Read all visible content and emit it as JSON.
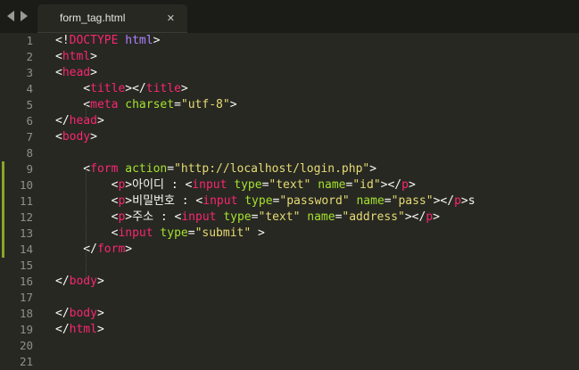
{
  "tab": {
    "title": "form_tag.html"
  },
  "lines": [
    {
      "n": "1",
      "parts": [
        [
          "p",
          "<!"
        ],
        [
          "t",
          "DOCTYPE"
        ],
        [
          "p",
          " "
        ],
        [
          "k",
          "html"
        ],
        [
          "p",
          ">"
        ]
      ]
    },
    {
      "n": "2",
      "parts": [
        [
          "p",
          "<"
        ],
        [
          "t",
          "html"
        ],
        [
          "p",
          ">"
        ]
      ]
    },
    {
      "n": "3",
      "parts": [
        [
          "p",
          "<"
        ],
        [
          "t",
          "head"
        ],
        [
          "p",
          ">"
        ]
      ]
    },
    {
      "n": "4",
      "parts": [
        [
          "p",
          "    <"
        ],
        [
          "t",
          "title"
        ],
        [
          "p",
          "></"
        ],
        [
          "t",
          "title"
        ],
        [
          "p",
          ">"
        ]
      ]
    },
    {
      "n": "5",
      "parts": [
        [
          "p",
          "    <"
        ],
        [
          "t",
          "meta"
        ],
        [
          "p",
          " "
        ],
        [
          "a",
          "charset"
        ],
        [
          "p",
          "="
        ],
        [
          "s",
          "\"utf-8\""
        ],
        [
          "p",
          ">"
        ]
      ]
    },
    {
      "n": "6",
      "parts": [
        [
          "p",
          "</"
        ],
        [
          "t",
          "head"
        ],
        [
          "p",
          ">"
        ]
      ]
    },
    {
      "n": "7",
      "parts": [
        [
          "p",
          "<"
        ],
        [
          "t",
          "body"
        ],
        [
          "p",
          ">"
        ]
      ]
    },
    {
      "n": "8",
      "parts": []
    },
    {
      "n": "9",
      "modified": true,
      "parts": [
        [
          "p",
          "    <"
        ],
        [
          "t",
          "form"
        ],
        [
          "p",
          " "
        ],
        [
          "a",
          "action"
        ],
        [
          "p",
          "="
        ],
        [
          "s",
          "\"http://localhost/login.php\""
        ],
        [
          "p",
          ">"
        ]
      ]
    },
    {
      "n": "10",
      "modified": true,
      "parts": [
        [
          "p",
          "        <"
        ],
        [
          "t",
          "p"
        ],
        [
          "p",
          ">아이디 : <"
        ],
        [
          "t",
          "input"
        ],
        [
          "p",
          " "
        ],
        [
          "a",
          "type"
        ],
        [
          "p",
          "="
        ],
        [
          "s",
          "\"text\""
        ],
        [
          "p",
          " "
        ],
        [
          "a",
          "name"
        ],
        [
          "p",
          "="
        ],
        [
          "s",
          "\"id\""
        ],
        [
          "p",
          "></"
        ],
        [
          "t",
          "p"
        ],
        [
          "p",
          ">"
        ]
      ]
    },
    {
      "n": "11",
      "modified": true,
      "parts": [
        [
          "p",
          "        <"
        ],
        [
          "t",
          "p"
        ],
        [
          "p",
          ">비밀번호 : <"
        ],
        [
          "t",
          "input"
        ],
        [
          "p",
          " "
        ],
        [
          "a",
          "type"
        ],
        [
          "p",
          "="
        ],
        [
          "s",
          "\"password\""
        ],
        [
          "p",
          " "
        ],
        [
          "a",
          "name"
        ],
        [
          "p",
          "="
        ],
        [
          "s",
          "\"pass\""
        ],
        [
          "p",
          "></"
        ],
        [
          "t",
          "p"
        ],
        [
          "p",
          ">s"
        ]
      ]
    },
    {
      "n": "12",
      "modified": true,
      "parts": [
        [
          "p",
          "        <"
        ],
        [
          "t",
          "p"
        ],
        [
          "p",
          ">주소 : <"
        ],
        [
          "t",
          "input"
        ],
        [
          "p",
          " "
        ],
        [
          "a",
          "type"
        ],
        [
          "p",
          "="
        ],
        [
          "s",
          "\"text\""
        ],
        [
          "p",
          " "
        ],
        [
          "a",
          "name"
        ],
        [
          "p",
          "="
        ],
        [
          "s",
          "\"address\""
        ],
        [
          "p",
          "></"
        ],
        [
          "t",
          "p"
        ],
        [
          "p",
          ">"
        ]
      ]
    },
    {
      "n": "13",
      "modified": true,
      "parts": [
        [
          "p",
          "        <"
        ],
        [
          "t",
          "input"
        ],
        [
          "p",
          " "
        ],
        [
          "a",
          "type"
        ],
        [
          "p",
          "="
        ],
        [
          "s",
          "\"submit\""
        ],
        [
          "p",
          " >"
        ]
      ]
    },
    {
      "n": "14",
      "modified": true,
      "parts": [
        [
          "p",
          "    </"
        ],
        [
          "t",
          "form"
        ],
        [
          "p",
          ">"
        ]
      ]
    },
    {
      "n": "15",
      "parts": []
    },
    {
      "n": "16",
      "parts": [
        [
          "p",
          "</"
        ],
        [
          "t",
          "body"
        ],
        [
          "p",
          ">"
        ]
      ]
    },
    {
      "n": "17",
      "parts": []
    },
    {
      "n": "18",
      "parts": [
        [
          "p",
          "</"
        ],
        [
          "t",
          "body"
        ],
        [
          "p",
          ">"
        ]
      ]
    },
    {
      "n": "19",
      "parts": [
        [
          "p",
          "</"
        ],
        [
          "t",
          "html"
        ],
        [
          "p",
          ">"
        ]
      ]
    },
    {
      "n": "20",
      "parts": []
    },
    {
      "n": "21",
      "parts": []
    }
  ],
  "theme": {
    "background": "#272822",
    "tag": "#f92672",
    "attribute": "#a6e22e",
    "string": "#e6db74",
    "keyword": "#ae81ff",
    "text": "#f8f8f2",
    "gutter_text": "#8f908a",
    "modified_marker": "#8aa62a"
  },
  "icons": {
    "back": "chevron-left-icon",
    "forward": "chevron-right-icon",
    "close": "close-icon"
  }
}
